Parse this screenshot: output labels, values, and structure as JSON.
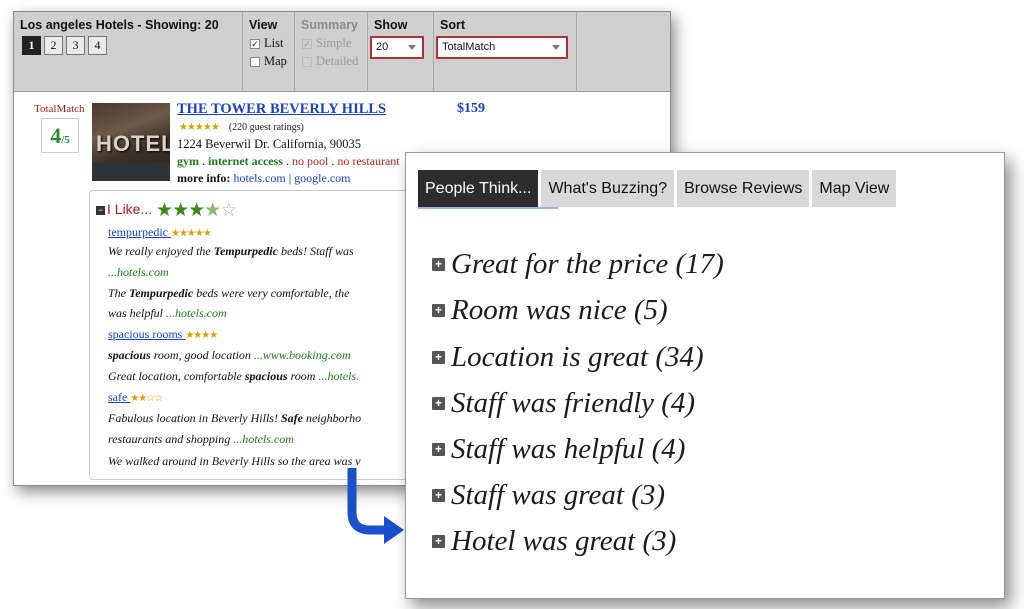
{
  "toolbar": {
    "results": {
      "title": "Los angeles Hotels - Showing: 20",
      "pages": [
        "1",
        "2",
        "3",
        "4"
      ],
      "active_page": "1"
    },
    "view": {
      "title": "View",
      "list": "List",
      "map": "Map"
    },
    "summary": {
      "title": "Summary",
      "simple": "Simple",
      "detailed": "Detailed"
    },
    "show": {
      "title": "Show",
      "value": "20"
    },
    "sort": {
      "title": "Sort",
      "value": "TotalMatch"
    }
  },
  "hotel": {
    "totalmatch_label": "TotalMatch",
    "score": "4",
    "score_den": "/5",
    "photo_text": "HOTEL",
    "name": "THE TOWER BEVERLY HILLS",
    "price": "$159",
    "rating_stars": "★★★★★",
    "ratings_text": "(220 guest ratings)",
    "address": "1224 Beverwil Dr. California, 90035",
    "amenities": {
      "gym": "gym",
      "internet": "internet access",
      "pool": "no pool",
      "restaurant": "no restaurant",
      "sep": " . "
    },
    "more_info_label": "more info:",
    "links": {
      "hotels": "hotels.com",
      "sep": " | ",
      "google": "google.com"
    }
  },
  "ilike": {
    "toggle": "−",
    "title": "I Like...",
    "stars_full": "★★★",
    "stars_half": "★",
    "stars_empty": "☆",
    "reviews": {
      "kw1": "tempurpedic",
      "kw1_stars": "★★★★★",
      "r1a_pre": "We really enjoyed the ",
      "r1a_kw": "Tempurpedic",
      "r1a_post": " beds! Staff was",
      "r1b_src": "...hotels.com",
      "r2a_pre": "The ",
      "r2a_kw": "Tempurpedic",
      "r2a_post": " beds were very comfortable, the",
      "r2b_pre": "was helpful ",
      "r2b_src": "...hotels.com",
      "kw2": "spacious rooms",
      "kw2_stars": "★★★★",
      "r3_kw": "spacious",
      "r3_post": " room, good location ",
      "r3_src": "...www.booking.com",
      "r4_pre": "Great location, comfortable ",
      "r4_kw": "spacious",
      "r4_post": " room ",
      "r4_src": "...hotels.",
      "kw3": "safe",
      "kw3_stars": "★★☆☆",
      "r5a_pre": "Fabulous location in Beverly Hills! ",
      "r5a_kw": "Safe",
      "r5a_post": " neighborho",
      "r5b_pre": "restaurants and shopping ",
      "r5b_src": "...hotels.com",
      "r6": "We walked around in Beverly Hills so the area was v"
    }
  },
  "panel2": {
    "tabs": [
      "People Think...",
      "What's Buzzing?",
      "Browse Reviews",
      "Map View"
    ],
    "plus": "+",
    "themes": [
      "Great for the price (17)",
      "Room was nice (5)",
      "Location is great (34)",
      "Staff was friendly (4)",
      "Staff was helpful (4)",
      "Staff was great (3)",
      "Hotel was great (3)"
    ]
  },
  "colors": {
    "arrow": "#1a4fd0",
    "link_blue": "#1a3fc9",
    "green": "#1e7a1e",
    "red": "#c0221f"
  }
}
